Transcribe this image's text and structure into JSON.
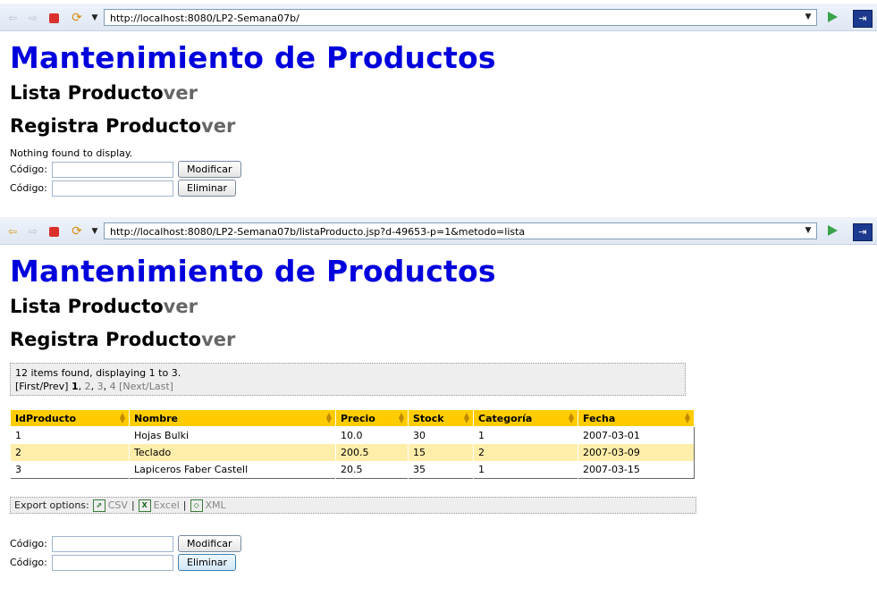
{
  "panes": [
    {
      "url": "http://localhost:8080/LP2-Semana07b/",
      "title": "Mantenimiento de Productos",
      "links": [
        {
          "text": "Lista Producto",
          "ver": "ver"
        },
        {
          "text": "Registra Producto",
          "ver": "ver"
        }
      ],
      "empty_message": "Nothing found to display.",
      "forms": [
        {
          "label": "Código:",
          "value": "",
          "button": "Modificar"
        },
        {
          "label": "Código:",
          "value": "",
          "button": "Eliminar"
        }
      ]
    },
    {
      "url": "http://localhost:8080/LP2-Semana07b/listaProducto.jsp?d-49653-p=1&metodo=lista",
      "title": "Mantenimiento de Productos",
      "links": [
        {
          "text": "Lista Producto",
          "ver": "ver"
        },
        {
          "text": "Registra Producto",
          "ver": "ver"
        }
      ],
      "banner": {
        "summary": "12 items found, displaying 1 to 3.",
        "prev": "[First/Prev]",
        "pages": [
          "1",
          "2",
          "3",
          "4"
        ],
        "next": "[Next/Last]"
      },
      "table": {
        "columns": [
          "IdProducto",
          "Nombre",
          "Precio",
          "Stock",
          "Categoría",
          "Fecha"
        ],
        "rows": [
          [
            "1",
            "Hojas Bulki",
            "10.0",
            "30",
            "1",
            "2007-03-01"
          ],
          [
            "2",
            "Teclado",
            "200.5",
            "15",
            "2",
            "2007-03-09"
          ],
          [
            "3",
            "Lapiceros Faber Castell",
            "20.5",
            "35",
            "1",
            "2007-03-15"
          ]
        ]
      },
      "export": {
        "label": "Export options:",
        "options": [
          "CSV",
          "Excel",
          "XML"
        ],
        "separator": "|"
      },
      "forms": [
        {
          "label": "Código:",
          "value": "",
          "button": "Modificar"
        },
        {
          "label": "Código:",
          "value": "",
          "button": "Eliminar"
        }
      ]
    }
  ],
  "colors": {
    "title": "#0000dd",
    "header": "#ffcc00",
    "even_row": "#ffeeaa"
  }
}
